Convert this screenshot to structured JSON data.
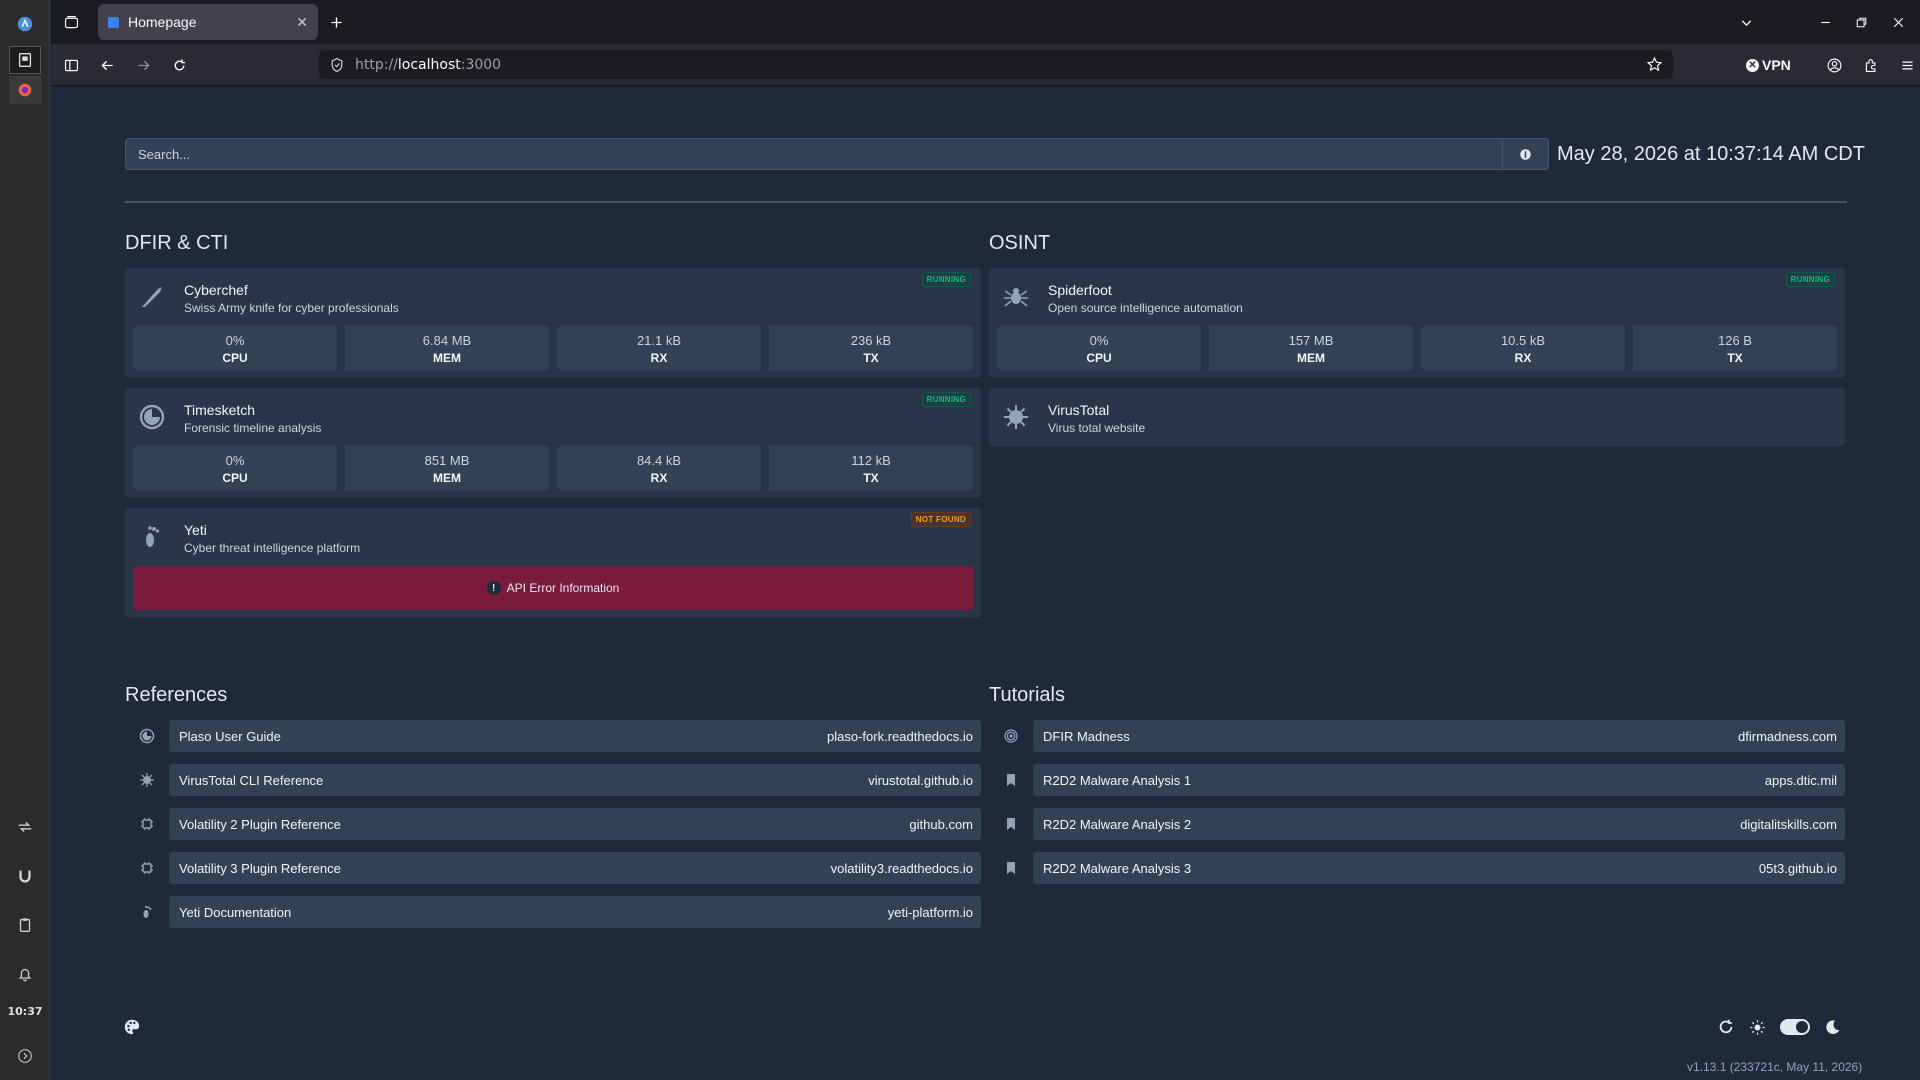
{
  "browser": {
    "tab_title": "Homepage",
    "url_prefix": "http://",
    "url_host": "localhost",
    "url_port": ":3000",
    "vpn_label": "VPN"
  },
  "taskbar": {
    "clock": "10:37"
  },
  "search": {
    "placeholder": "Search..."
  },
  "datetime": "May 28, 2026 at 10:37:14 AM CDT",
  "sections": {
    "dfir": {
      "title": "DFIR & CTI",
      "services": [
        {
          "name": "Cyberchef",
          "desc": "Swiss Army knife for cyber professionals",
          "status": "RUNNING",
          "icon": "knife-icon",
          "cpu": "0%",
          "mem": "6.84 MB",
          "rx": "21.1 kB",
          "tx": "236 kB"
        },
        {
          "name": "Timesketch",
          "desc": "Forensic timeline analysis",
          "status": "RUNNING",
          "icon": "timeline-icon",
          "cpu": "0%",
          "mem": "851 MB",
          "rx": "84.4 kB",
          "tx": "112 kB"
        },
        {
          "name": "Yeti",
          "desc": "Cyber threat intelligence platform",
          "status": "NOT FOUND",
          "icon": "footprint-icon",
          "error": "API Error Information"
        }
      ]
    },
    "osint": {
      "title": "OSINT",
      "services": [
        {
          "name": "Spiderfoot",
          "desc": "Open source intelligence automation",
          "status": "RUNNING",
          "icon": "spider-icon",
          "cpu": "0%",
          "mem": "157 MB",
          "rx": "10.5 kB",
          "tx": "126 B"
        },
        {
          "name": "VirusTotal",
          "desc": "Virus total website",
          "icon": "virus-icon"
        }
      ]
    }
  },
  "stat_labels": {
    "cpu": "CPU",
    "mem": "MEM",
    "rx": "RX",
    "tx": "TX"
  },
  "references": {
    "title": "References",
    "items": [
      {
        "name": "Plaso User Guide",
        "host": "plaso-fork.readthedocs.io",
        "icon": "timeline-icon"
      },
      {
        "name": "VirusTotal CLI Reference",
        "host": "virustotal.github.io",
        "icon": "virus-icon"
      },
      {
        "name": "Volatility 2 Plugin Reference",
        "host": "github.com",
        "icon": "chip-icon"
      },
      {
        "name": "Volatility 3 Plugin Reference",
        "host": "volatility3.readthedocs.io",
        "icon": "chip-icon"
      },
      {
        "name": "Yeti Documentation",
        "host": "yeti-platform.io",
        "icon": "footprint-icon"
      }
    ]
  },
  "tutorials": {
    "title": "Tutorials",
    "items": [
      {
        "name": "DFIR Madness",
        "host": "dfirmadness.com",
        "icon": "fingerprint-icon"
      },
      {
        "name": "R2D2 Malware Analysis 1",
        "host": "apps.dtic.mil",
        "icon": "bookmark-icon"
      },
      {
        "name": "R2D2 Malware Analysis 2",
        "host": "digitalitskills.com",
        "icon": "bookmark-icon"
      },
      {
        "name": "R2D2 Malware Analysis 3",
        "host": "05t3.github.io",
        "icon": "bookmark-icon"
      }
    ]
  },
  "footer": {
    "version": "v1.13.1 (233721c, May 11, 2026)"
  }
}
